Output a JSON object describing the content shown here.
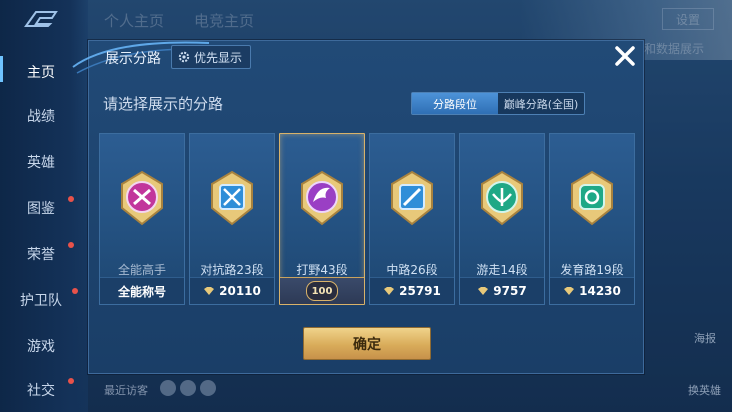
{
  "sidebar": {
    "items": [
      {
        "label": "主页",
        "active": true
      },
      {
        "label": "战绩"
      },
      {
        "label": "英雄"
      },
      {
        "label": "图鉴"
      },
      {
        "label": "荣誉"
      },
      {
        "label": "护卫队"
      },
      {
        "label": "游戏"
      },
      {
        "label": "社交"
      }
    ]
  },
  "header": {
    "tabs": [
      "个人主页",
      "电竞主页"
    ],
    "settings_label": "设置",
    "data_display_label": "和数据展示"
  },
  "modal": {
    "title": "展示分路",
    "priority_button": "优先显示",
    "subtitle": "请选择展示的分路",
    "toggle": {
      "options": [
        "分路段位",
        "巅峰分路(全国)"
      ],
      "selected": 0
    },
    "cards": [
      {
        "name": "全能高手",
        "footer": "全能称号",
        "badge_color": "#c2369c",
        "selected": false
      },
      {
        "name": "对抗路23段",
        "footer": "20110",
        "badge_color": "#2f8ed8",
        "selected": false
      },
      {
        "name": "打野43段",
        "footer": "100",
        "badge_color": "#9a3fc4",
        "selected": true
      },
      {
        "name": "中路26段",
        "footer": "25791",
        "badge_color": "#2f8ed8",
        "selected": false
      },
      {
        "name": "游走14段",
        "footer": "9757",
        "badge_color": "#1ea886",
        "selected": false
      },
      {
        "name": "发育路19段",
        "footer": "14230",
        "badge_color": "#1ea886",
        "selected": false
      }
    ],
    "confirm_label": "确定"
  },
  "bottom": {
    "recent_visitors_label": "最近访客",
    "right_labels": [
      "海报",
      "换英雄"
    ]
  },
  "colors": {
    "accent_gold": "#d9ac5a",
    "panel_blue": "#214a77",
    "toggle_selected": "#2f6fb5"
  }
}
